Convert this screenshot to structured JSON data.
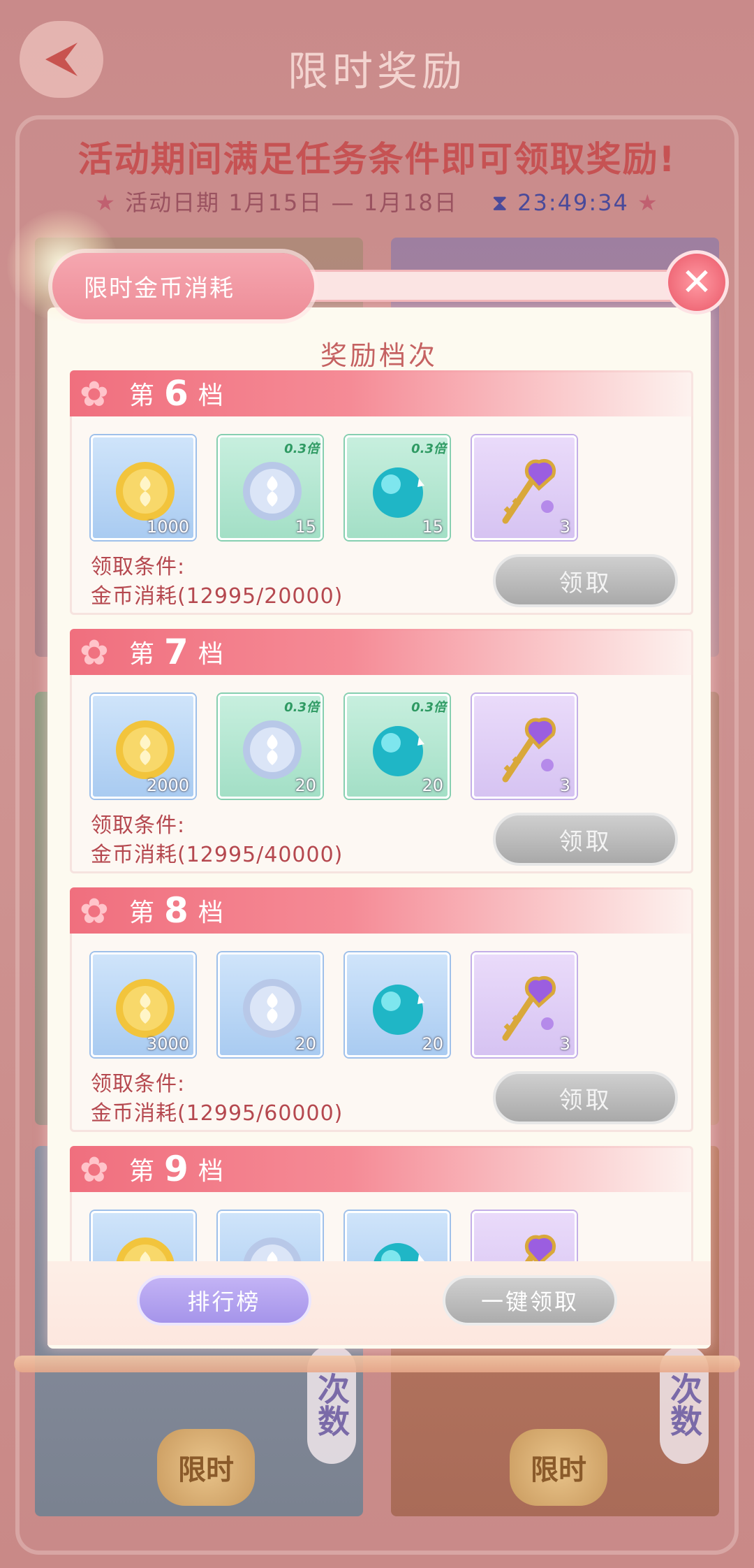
{
  "header": {
    "title": "限时奖励",
    "banner": "活动期间满足任务条件即可领取奖励!",
    "date_label": "活动日期",
    "date_range": "1月15日 — 1月18日",
    "countdown": "23:49:34"
  },
  "background": {
    "limited_badge": "限时",
    "times_tag": "次数"
  },
  "modal": {
    "tab_label": "限时金币消耗",
    "section_title": "奖励档次",
    "tier_prefix": "第",
    "tier_suffix": "档",
    "condition_label": "领取条件:",
    "claim_label": "领取",
    "tiers": [
      {
        "level": "6",
        "items": [
          {
            "icon": "gold-coin-icon",
            "count": "1000"
          },
          {
            "icon": "silver-coin-icon",
            "count": "15",
            "mult": "0.3倍"
          },
          {
            "icon": "teal-orb-icon",
            "count": "15",
            "mult": "0.3倍"
          },
          {
            "icon": "golden-key-icon",
            "count": "3"
          }
        ],
        "condition": "金币消耗(12995/20000)"
      },
      {
        "level": "7",
        "items": [
          {
            "icon": "gold-coin-icon",
            "count": "2000"
          },
          {
            "icon": "silver-coin-icon",
            "count": "20",
            "mult": "0.3倍"
          },
          {
            "icon": "teal-orb-icon",
            "count": "20",
            "mult": "0.3倍"
          },
          {
            "icon": "golden-key-icon",
            "count": "3"
          }
        ],
        "condition": "金币消耗(12995/40000)"
      },
      {
        "level": "8",
        "items": [
          {
            "icon": "gold-coin-icon",
            "count": "3000"
          },
          {
            "icon": "silver-coin-icon",
            "count": "20"
          },
          {
            "icon": "teal-orb-icon",
            "count": "20"
          },
          {
            "icon": "golden-key-icon",
            "count": "3"
          }
        ],
        "condition": "金币消耗(12995/60000)"
      },
      {
        "level": "9",
        "items": [
          {
            "icon": "gold-coin-icon"
          },
          {
            "icon": "silver-coin-icon"
          },
          {
            "icon": "teal-orb-icon"
          },
          {
            "icon": "golden-key-icon"
          }
        ]
      }
    ]
  },
  "bottom": {
    "leaderboard": "排行榜",
    "claim_all": "一键领取"
  }
}
